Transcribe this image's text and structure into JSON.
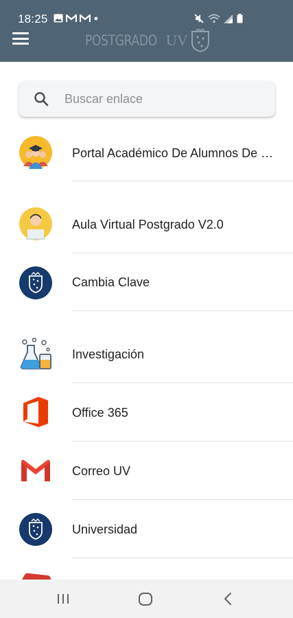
{
  "status_bar": {
    "time": "18:25",
    "left_icons": [
      "gallery-icon",
      "mail-m-icon",
      "mail-m-icon",
      "dot-icon"
    ],
    "right_icons": [
      "mute-icon",
      "wifi-icon",
      "signal-icon",
      "battery-icon"
    ]
  },
  "header": {
    "brand_text": "POSTGRADO",
    "brand_uv": "UV",
    "menu_icon": "hamburger-menu-icon",
    "logo_icon": "university-shield-icon",
    "background_color": "#4f6475"
  },
  "search": {
    "placeholder": "Buscar enlace",
    "value": "",
    "icon": "search-icon"
  },
  "links": [
    {
      "label": "Portal Académico De Alumnos De Postgrado",
      "icon": "students-graduates-icon"
    },
    {
      "label": "Aula Virtual Postgrado V2.0",
      "icon": "student-laptop-icon"
    },
    {
      "label": "Cambia Clave",
      "icon": "university-crest-icon"
    },
    {
      "label": "Investigación",
      "icon": "lab-flasks-icon"
    },
    {
      "label": "Office 365",
      "icon": "office-logo-icon"
    },
    {
      "label": "Correo UV",
      "icon": "gmail-icon"
    },
    {
      "label": "Universidad",
      "icon": "university-crest-icon"
    }
  ],
  "nav": {
    "recents_icon": "recent-apps-icon",
    "home_icon": "home-icon",
    "back_icon": "back-icon"
  }
}
